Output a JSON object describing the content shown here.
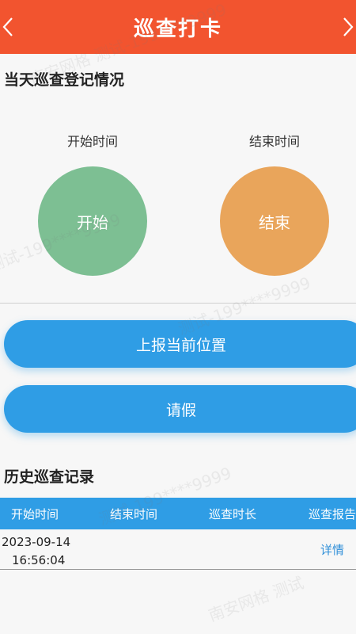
{
  "header": {
    "title": "巡查打卡",
    "back_icon": "chevron-left-icon",
    "forward_icon": "chevron-right-icon"
  },
  "today": {
    "section_title": "当天巡查登记情况",
    "start_label": "开始时间",
    "end_label": "结束时间",
    "start_button": "开始",
    "end_button": "结束",
    "start_color": "#7dbf93",
    "end_color": "#e9a55b"
  },
  "actions": {
    "report_location": "上报当前位置",
    "leave": "请假"
  },
  "history": {
    "section_title": "历史巡查记录",
    "columns": [
      "开始时间",
      "结束时间",
      "巡查时长",
      "巡查报告"
    ],
    "rows": [
      {
        "start_date": "2023-09-14",
        "start_time": "16:56:04",
        "end": "",
        "duration": "",
        "report_link": "详情"
      }
    ]
  },
  "watermarks": [
    "南安网格 测试-199****9999",
    "测试-199****9999",
    "南安网格 测试"
  ],
  "colors": {
    "header": "#f2542f",
    "primary": "#2f9de5"
  }
}
